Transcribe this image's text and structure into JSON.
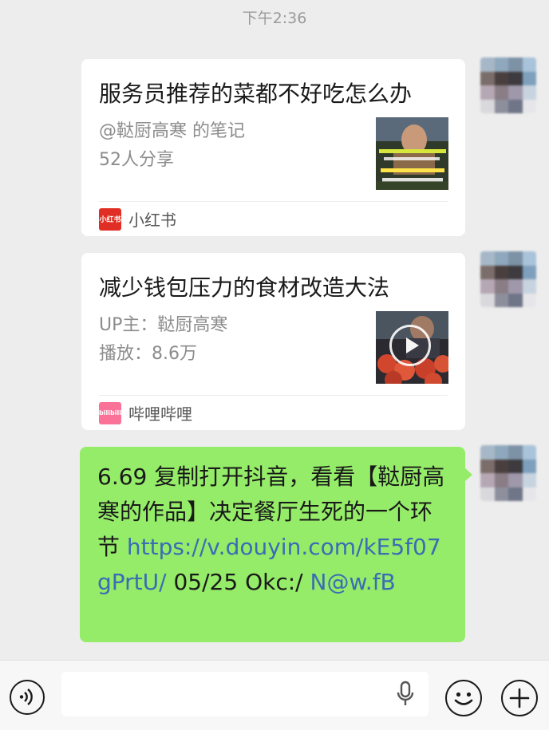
{
  "status": {
    "time": "下午2:36"
  },
  "messages": [
    {
      "type": "share-card",
      "title": "服务员推荐的菜都不好吃怎么办",
      "line1": "@鞑厨高寒 的笔记",
      "line2": "52人分享",
      "source": {
        "name": "小红书",
        "logo_text": "小红书",
        "color": "#e02e24"
      }
    },
    {
      "type": "share-card",
      "title": "减少钱包压力的食材改造大法",
      "line1": "UP主：鞑厨高寒",
      "line2": "播放：8.6万",
      "source": {
        "name": "哔哩哔哩",
        "logo_text": "bilibili",
        "color": "#fb7299"
      }
    },
    {
      "type": "text",
      "text_before": "6.69 复制打开抖音，看看【鞑厨高寒的作品】决定餐厅生死的一个环节  ",
      "link": "https://v.douyin.com/kE5f07gPrtU/",
      "text_mid": " 05/25 Okc:/ ",
      "link2": "N@w.fB"
    }
  ],
  "input": {
    "placeholder": ""
  },
  "icons": [
    "voice-icon",
    "microphone-icon",
    "emoji-icon",
    "plus-icon",
    "play-icon"
  ],
  "colors": {
    "bubble": "#95ec69",
    "link": "#3a6cb4",
    "background": "#ededed"
  }
}
